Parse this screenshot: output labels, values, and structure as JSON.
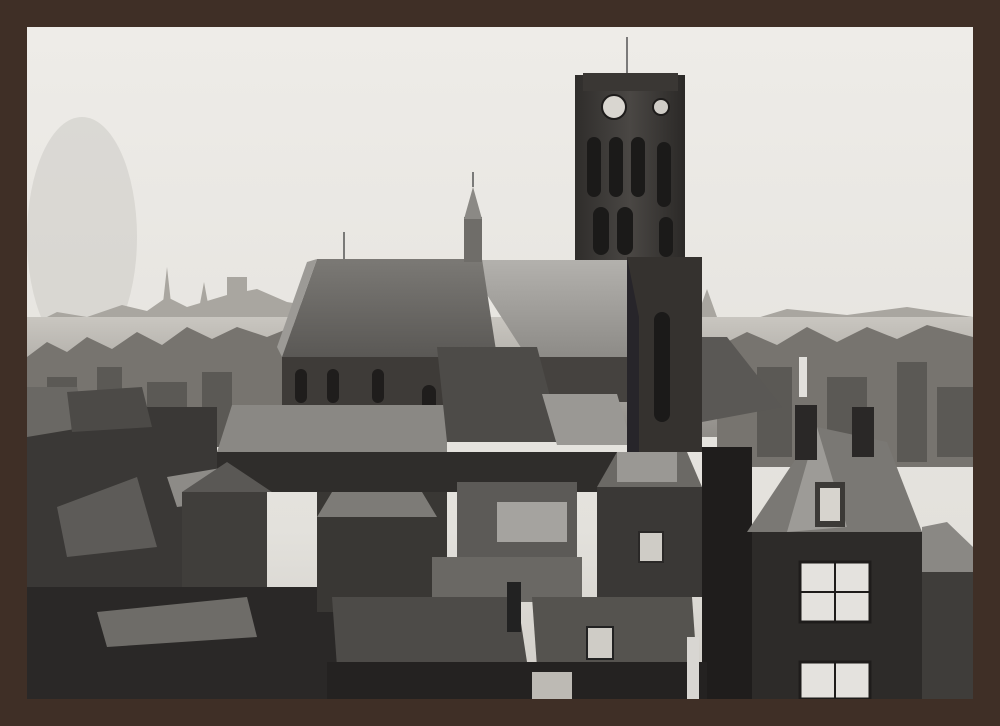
{
  "image": {
    "subject": "church-tower-city-roofs",
    "tone": "monochrome",
    "colors": {
      "frame": "#3f2f26",
      "sky": "#e9e7e3",
      "haze": "#b9b5ae",
      "roof_light": "#8a8883",
      "roof_dark": "#4a4845",
      "wall_dark": "#2e2c2a",
      "shadow": "#1e1c1b"
    }
  }
}
